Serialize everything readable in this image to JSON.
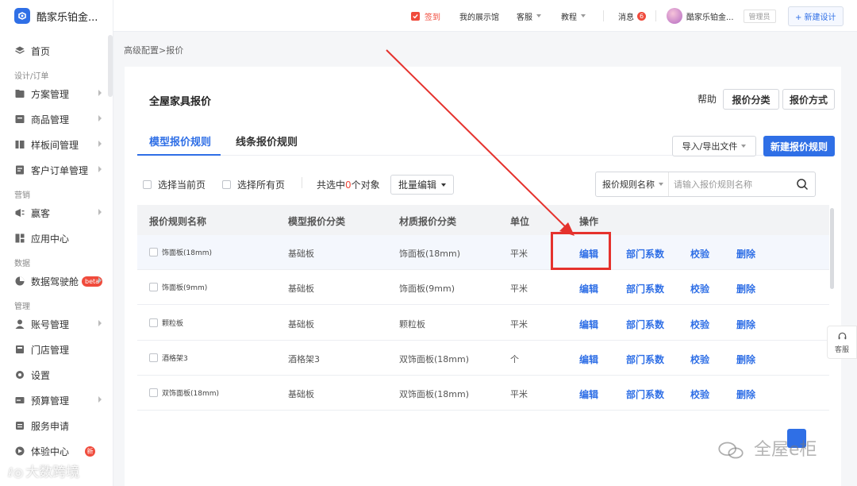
{
  "app": {
    "name": "酷家乐铂金..."
  },
  "sidebar": {
    "items": [
      {
        "key": "home",
        "label": "首页",
        "icon": "home-icon",
        "arrow": false
      },
      {
        "key": "group-design",
        "group": "设计/订单"
      },
      {
        "key": "plan",
        "label": "方案管理",
        "icon": "folder-icon",
        "arrow": true
      },
      {
        "key": "product",
        "label": "商品管理",
        "icon": "box-icon",
        "arrow": true
      },
      {
        "key": "showroom",
        "label": "样板间管理",
        "icon": "showroom-icon",
        "arrow": true
      },
      {
        "key": "orders",
        "label": "客户订单管理",
        "icon": "order-icon",
        "arrow": true
      },
      {
        "key": "group-marketing",
        "group": "营销"
      },
      {
        "key": "win",
        "label": "赢客",
        "icon": "megaphone-icon",
        "arrow": true
      },
      {
        "key": "apps",
        "label": "应用中心",
        "icon": "apps-icon",
        "arrow": false
      },
      {
        "key": "group-data",
        "group": "数据"
      },
      {
        "key": "cockpit",
        "label": "数据驾驶舱",
        "icon": "pie-icon",
        "arrow": true,
        "badge": "beta"
      },
      {
        "key": "group-manage",
        "group": "管理"
      },
      {
        "key": "account",
        "label": "账号管理",
        "icon": "user-icon",
        "arrow": true
      },
      {
        "key": "store",
        "label": "门店管理",
        "icon": "store-icon",
        "arrow": false
      },
      {
        "key": "settings",
        "label": "设置",
        "icon": "gear-icon",
        "arrow": false
      },
      {
        "key": "budget",
        "label": "预算管理",
        "icon": "budget-icon",
        "arrow": true
      },
      {
        "key": "service",
        "label": "服务申请",
        "icon": "service-icon",
        "arrow": false
      },
      {
        "key": "experience",
        "label": "体验中心",
        "icon": "experience-icon",
        "arrow": false,
        "badge": "新"
      }
    ]
  },
  "topbar": {
    "checkin": "签到",
    "showroom": "我的展示馆",
    "support": "客服",
    "tutorial": "教程",
    "messages": "消息",
    "message_count": "6",
    "user": "酷家乐铂金...",
    "role": "管理员",
    "new_design": "+ 新建设计"
  },
  "breadcrumb": "高级配置>报价",
  "page": {
    "title": "全屋家具报价",
    "help": "帮助",
    "btn_category": "报价分类",
    "btn_method": "报价方式",
    "tabs": [
      "模型报价规则",
      "线条报价规则"
    ],
    "import_export": "导入/导出文件",
    "new_rule": "新建报价规则"
  },
  "filters": {
    "select_page": "选择当前页",
    "select_all": "选择所有页",
    "selected_prefix": "共选中",
    "selected_count": "0",
    "selected_suffix": "个对象",
    "batch_edit": "批量编辑",
    "search_field": "报价规则名称",
    "search_placeholder": "请输入报价规则名称"
  },
  "table": {
    "headers": [
      "报价规则名称",
      "模型报价分类",
      "材质报价分类",
      "单位",
      "操作"
    ],
    "rows": [
      {
        "name": "饰面板(18mm)",
        "model_cat": "基础板",
        "material_cat": "饰面板(18mm)",
        "unit": "平米"
      },
      {
        "name": "饰面板(9mm)",
        "model_cat": "基础板",
        "material_cat": "饰面板(9mm)",
        "unit": "平米"
      },
      {
        "name": "颗粒板",
        "model_cat": "基础板",
        "material_cat": "颗粒板",
        "unit": "平米"
      },
      {
        "name": "酒格架3",
        "model_cat": "酒格架3",
        "material_cat": "双饰面板(18mm)",
        "unit": "个"
      },
      {
        "name": "双饰面板(18mm)",
        "model_cat": "基础板",
        "material_cat": "双饰面板(18mm)",
        "unit": "平米"
      }
    ],
    "actions": [
      "编辑",
      "部门系数",
      "校验",
      "删除"
    ]
  },
  "float": {
    "service": "客服"
  },
  "watermarks": {
    "brand": "全屋e柜",
    "corner": "大数跨境"
  },
  "colors": {
    "accent": "#2f6fe6",
    "danger": "#e5322d",
    "badge": "#f04b3c"
  }
}
